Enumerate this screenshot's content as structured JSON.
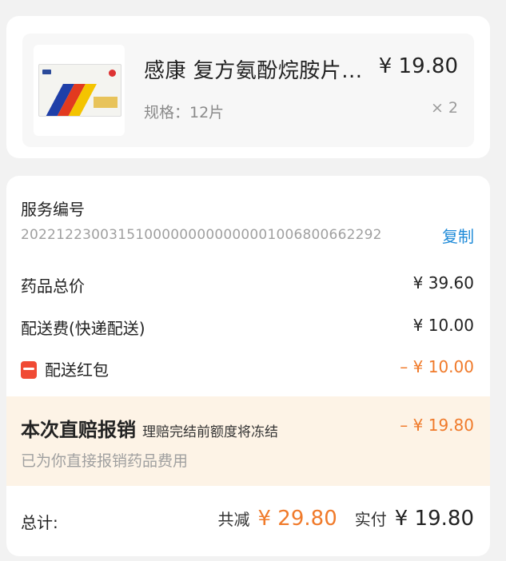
{
  "product": {
    "name": "感康 复方氨酚烷胺片...",
    "price": "¥ 19.80",
    "spec": "规格：12片",
    "quantity": "× 2",
    "image_icon": "medicine-box-image"
  },
  "order": {
    "service_label": "服务编号",
    "service_number": "20221223003151000000000000001006800662292",
    "copy_label": "复制",
    "drug_total_label": "药品总价",
    "drug_total_value": "¥ 39.60",
    "delivery_label": "配送费(快递配送)",
    "delivery_value": "¥ 10.00",
    "red_packet_label": "配送红包",
    "red_packet_value": "– ¥ 10.00",
    "claim": {
      "title": "本次直赔报销",
      "note": "理赔完结前额度将冻结",
      "amount": "– ¥ 19.80",
      "subtitle": "已为你直接报销药品费用"
    },
    "summary": {
      "total_label": "总计:",
      "saved_label": "共减",
      "saved_value": "¥ 29.80",
      "paid_label": "实付",
      "paid_value": "¥ 19.80"
    }
  },
  "colors": {
    "accent_orange": "#f07a2a",
    "link_blue": "#1e8ad8",
    "claim_bg": "#fdf3e6"
  }
}
